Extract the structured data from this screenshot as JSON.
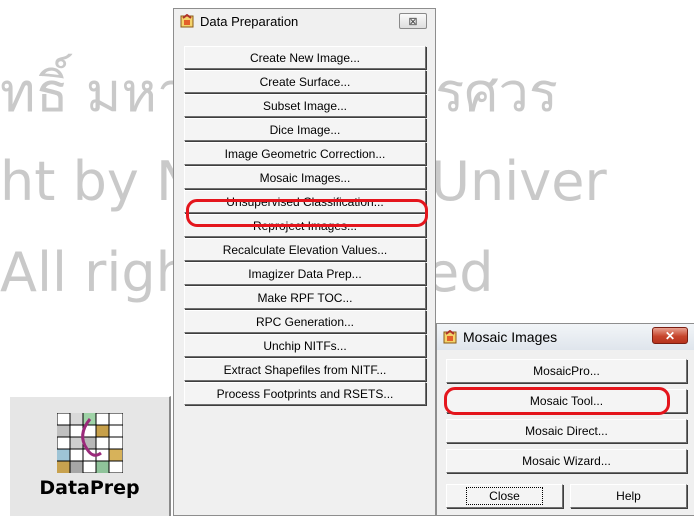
{
  "watermark": {
    "line1": "ทธิ์ มหาวิทยาลัยนเรศวร",
    "line2": "ht by Naresuan Univer",
    "line3": "All rights reserved"
  },
  "launcher": {
    "label": "DataPrep",
    "icon": "dataprep-grid-icon"
  },
  "data_prep_window": {
    "title": "Data Preparation",
    "close_symbol": "⊠",
    "buttons": [
      "Create New Image...",
      "Create Surface...",
      "Subset Image...",
      "Dice Image...",
      "Image Geometric Correction...",
      "Mosaic Images...",
      "Unsupervised Classification...",
      "Reproject Images...",
      "Recalculate Elevation Values...",
      "Imagizer Data Prep...",
      "Make RPF TOC...",
      "RPC Generation...",
      "Unchip NITFs...",
      "Extract Shapefiles from NITF...",
      "Process Footprints and RSETS..."
    ]
  },
  "mosaic_window": {
    "title": "Mosaic Images",
    "close_symbol": "✕",
    "buttons": [
      "MosaicPro...",
      "Mosaic Tool...",
      "Mosaic Direct...",
      "Mosaic Wizard..."
    ],
    "close_label": "Close",
    "help_label": "Help"
  },
  "colors": {
    "highlight": "#e4151c",
    "window_bg": "#f0f0f0"
  }
}
